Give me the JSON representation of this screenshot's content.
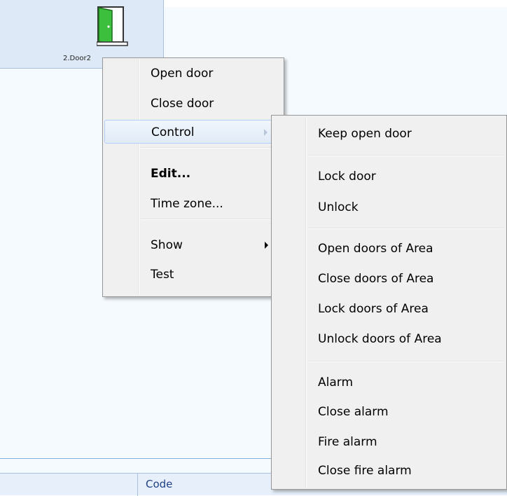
{
  "door": {
    "label": "2.Door2",
    "icon": "door-open-icon"
  },
  "grid": {
    "code_header": "Code"
  },
  "context_menu": {
    "items": [
      {
        "label": "Open door"
      },
      {
        "label": "Close door"
      },
      {
        "label": "Control",
        "submenu": true,
        "highlighted": true
      },
      {
        "label": "Edit...",
        "bold": true
      },
      {
        "label": "Time zone..."
      },
      {
        "label": "Show",
        "submenu": true
      },
      {
        "label": "Test"
      }
    ]
  },
  "control_submenu": {
    "items": [
      {
        "label": "Keep open door"
      },
      {
        "label": "Lock door"
      },
      {
        "label": "Unlock"
      },
      {
        "label": "Open doors of Area"
      },
      {
        "label": "Close doors of Area"
      },
      {
        "label": "Lock doors of Area"
      },
      {
        "label": "Unlock doors of Area"
      },
      {
        "label": "Alarm"
      },
      {
        "label": "Close alarm"
      },
      {
        "label": "Fire alarm"
      },
      {
        "label": "Close fire alarm"
      }
    ]
  },
  "colors": {
    "door_green": "#3cbf3c",
    "highlight_border": "#aecff7",
    "code_text": "#1f3f86"
  }
}
